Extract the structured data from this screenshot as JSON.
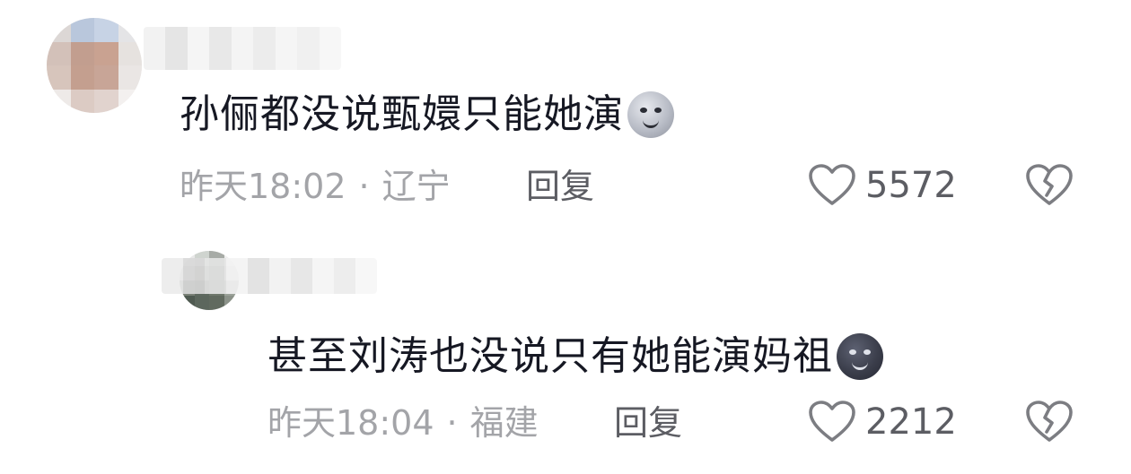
{
  "comments": [
    {
      "text": "孙俪都没说甄嬛只能她演",
      "emoji": "full-moon-face-icon",
      "time": "昨天18:02",
      "separator": "·",
      "location": "辽宁",
      "reply_label": "回复",
      "like_count": "5572"
    },
    {
      "text": "甚至刘涛也没说只有她能演妈祖",
      "emoji": "new-moon-face-icon",
      "time": "昨天18:04",
      "separator": "·",
      "location": "福建",
      "reply_label": "回复",
      "like_count": "2212"
    }
  ],
  "colors": {
    "text_primary": "#161823",
    "text_secondary": "#a3a4a8",
    "action": "#5c5d63"
  }
}
